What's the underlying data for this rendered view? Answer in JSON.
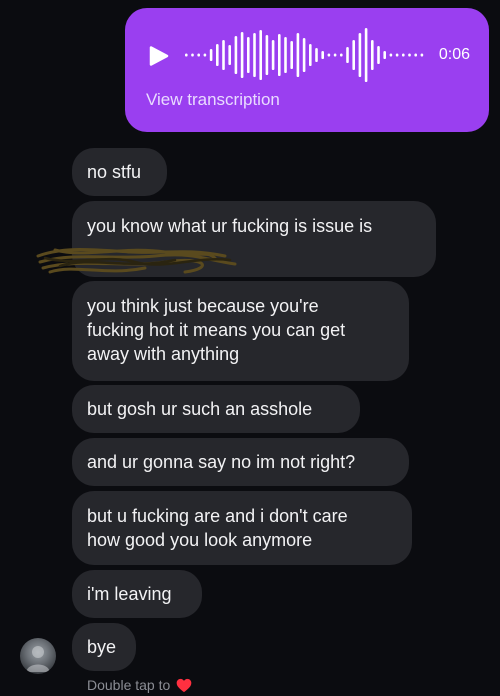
{
  "voice_message": {
    "duration": "0:06",
    "transcription_label": "View transcription",
    "icon": "play-icon",
    "bubble_color": "#9a3ff0"
  },
  "messages": [
    {
      "text": "no stfu"
    },
    {
      "text": "you know what ur fucking is issue is"
    },
    {
      "text": "you think just because you're\nfucking hot it means you can get\naway with anything"
    },
    {
      "text": "but gosh ur such an asshole"
    },
    {
      "text": "and ur gonna say no im not right?"
    },
    {
      "text": "but u fucking are and i don't care\nhow good you look anymore"
    },
    {
      "text": "i'm leaving"
    },
    {
      "text": "bye"
    }
  ],
  "footer": {
    "double_tap_label": "Double tap to",
    "icon": "heart-icon",
    "heart_color": "#ff3040"
  },
  "colors": {
    "background": "#0b0c10",
    "received_bubble": "#26272c",
    "text": "#f2f2f4"
  }
}
